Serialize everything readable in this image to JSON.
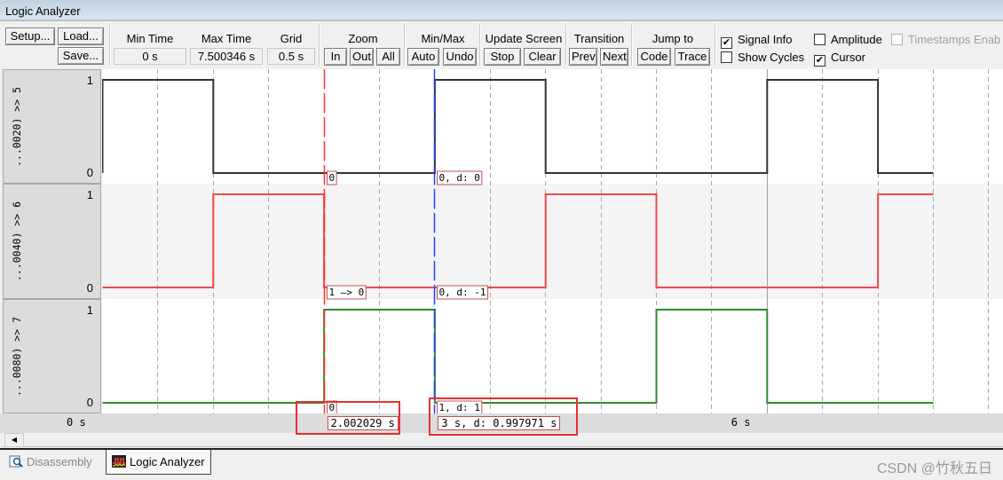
{
  "window": {
    "title": "Logic Analyzer"
  },
  "toolbar": {
    "setup": "Setup...",
    "load": "Load...",
    "save": "Save...",
    "min_time_label": "Min Time",
    "min_time_value": "0 s",
    "max_time_label": "Max Time",
    "max_time_value": "7.500346 s",
    "grid_label": "Grid",
    "grid_value": "0.5 s",
    "zoom_label": "Zoom",
    "zoom_in": "In",
    "zoom_out": "Out",
    "zoom_all": "All",
    "minmax_label": "Min/Max",
    "minmax_auto": "Auto",
    "minmax_undo": "Undo",
    "update_label": "Update Screen",
    "update_stop": "Stop",
    "update_clear": "Clear",
    "transition_label": "Transition",
    "transition_prev": "Prev",
    "transition_next": "Next",
    "jump_label": "Jump to",
    "jump_code": "Code",
    "jump_trace": "Trace",
    "checkboxes": {
      "signal_info": {
        "label": "Signal Info",
        "checked": true
      },
      "amplitude": {
        "label": "Amplitude",
        "checked": false
      },
      "timestamps": {
        "label": "Timestamps Enab",
        "checked": false,
        "disabled": true
      },
      "show_cycles": {
        "label": "Show Cycles",
        "checked": false
      },
      "cursor": {
        "label": "Cursor",
        "checked": true
      }
    }
  },
  "signals": [
    {
      "name": "...0020) >> 5",
      "high_label": "1",
      "low_label": "0",
      "color": "#333333",
      "transitions": [
        [
          0,
          1
        ],
        [
          1,
          0
        ],
        [
          3,
          1
        ],
        [
          4,
          0
        ],
        [
          6,
          1
        ],
        [
          7,
          0
        ]
      ]
    },
    {
      "name": "...0040) >> 6",
      "high_label": "1",
      "low_label": "0",
      "color": "#f04848",
      "transitions": [
        [
          0,
          0
        ],
        [
          1,
          1
        ],
        [
          2,
          0
        ],
        [
          4,
          1
        ],
        [
          5,
          0
        ],
        [
          7,
          1
        ]
      ]
    },
    {
      "name": "...0080) >> 7",
      "high_label": "1",
      "low_label": "0",
      "color": "#2e8b2e",
      "transitions": [
        [
          0,
          0
        ],
        [
          2,
          1
        ],
        [
          3,
          0
        ],
        [
          5,
          1
        ],
        [
          6,
          0
        ]
      ]
    }
  ],
  "time": {
    "min": 0,
    "max": 7.5,
    "grid": 0.5,
    "view_end": 8.05
  },
  "time_axis": {
    "labels": [
      {
        "t": 0,
        "text": "0 s"
      },
      {
        "t": 6,
        "text": "6 s"
      }
    ]
  },
  "cursors": {
    "red": {
      "t": 2.0,
      "color": "#ff3030",
      "time_label": "2.002029 s",
      "values": [
        "0",
        "1 —> 0",
        "0"
      ]
    },
    "blue": {
      "t": 3.0,
      "color": "#2040ff",
      "time_label": "3 s,   d: 0.997971 s",
      "values": [
        "0,   d: 0",
        "0,   d: -1",
        "1,   d: 1"
      ]
    }
  },
  "tabs": [
    {
      "label": "Disassembly",
      "active": false
    },
    {
      "label": "Logic Analyzer",
      "active": true
    }
  ],
  "watermark": "CSDN @竹秋五日"
}
